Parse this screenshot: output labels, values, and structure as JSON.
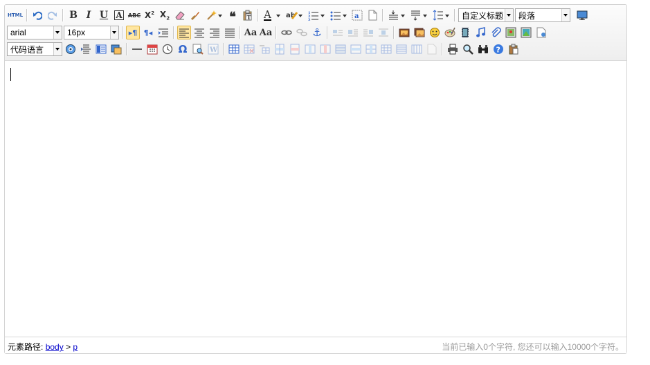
{
  "toolbar": {
    "html_label": "HTML",
    "custom_title_select": "自定义标题",
    "paragraph_select": "段落",
    "font_family_select": "arial",
    "font_size_select": "16px",
    "code_language_select": "代码语言"
  },
  "statusbar": {
    "path_label": "元素路径:",
    "path_body": "body",
    "path_separator": ">",
    "path_p": "p",
    "char_count": "当前已输入0个字符, 您还可以输入10000个字符。"
  },
  "colors": {
    "active_bg": "#ffe6a0",
    "link": "#0000cc",
    "hint": "#999999"
  }
}
